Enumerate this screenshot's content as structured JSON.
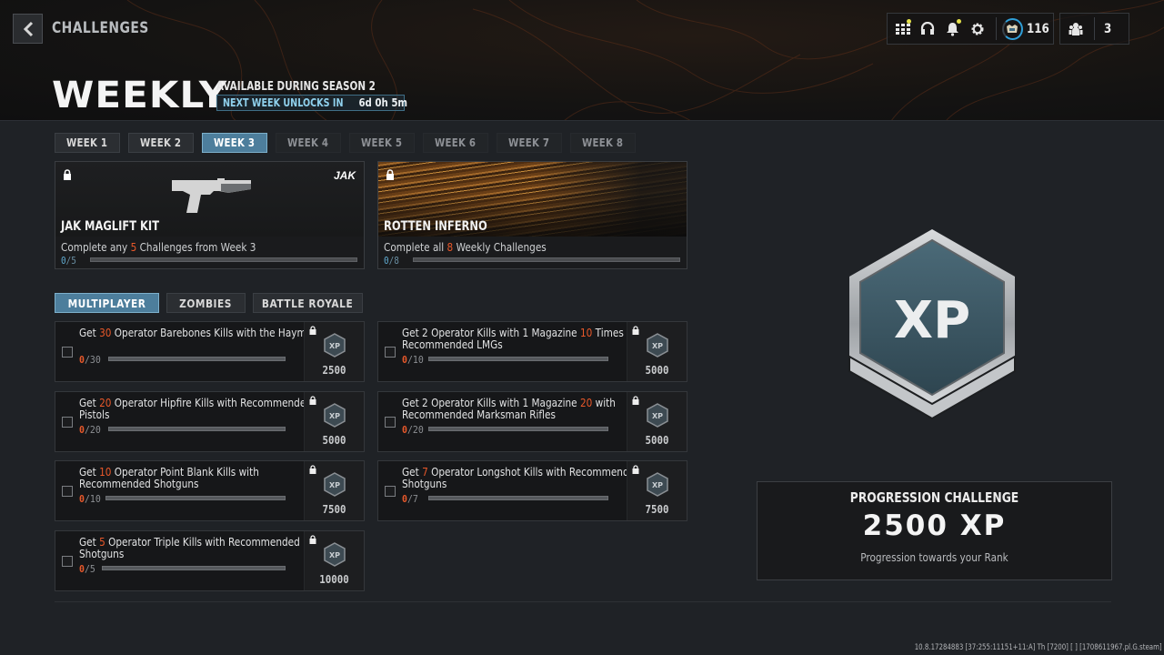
{
  "header": {
    "breadcrumb": "CHALLENGES",
    "title": "WEEKLY",
    "season": "AVAILABLE DURING SEASON 2",
    "unlock_label": "NEXT WEEK UNLOCKS IN",
    "unlock_time": "6d 0h 5m"
  },
  "hud": {
    "icons": [
      "apps-grid-icon",
      "headset-icon",
      "bell-icon",
      "gear-icon"
    ],
    "rank_level": "116",
    "party_count": "3"
  },
  "weeks": [
    {
      "label": "WEEK 1",
      "state": "done"
    },
    {
      "label": "WEEK 2",
      "state": "done"
    },
    {
      "label": "WEEK 3",
      "state": "active"
    },
    {
      "label": "WEEK 4",
      "state": "locked"
    },
    {
      "label": "WEEK 5",
      "state": "locked"
    },
    {
      "label": "WEEK 6",
      "state": "locked"
    },
    {
      "label": "WEEK 7",
      "state": "locked"
    },
    {
      "label": "WEEK 8",
      "state": "locked"
    }
  ],
  "rewards": [
    {
      "name": "JAK MAGLIFT KIT",
      "brand": "JAK",
      "desc_pre": "Complete any ",
      "desc_num": "5",
      "desc_post": " Challenges from Week 3",
      "current": "0",
      "total": "5",
      "progress": 0
    },
    {
      "name": "ROTTEN INFERNO",
      "desc_pre": "Complete all ",
      "desc_num": "8",
      "desc_post": " Weekly Challenges",
      "current": "0",
      "total": "8",
      "progress": 0
    }
  ],
  "modes": [
    {
      "label": "MULTIPLAYER",
      "active": true
    },
    {
      "label": "ZOMBIES",
      "active": false
    },
    {
      "label": "BATTLE ROYALE",
      "active": false
    }
  ],
  "challenges": [
    {
      "pre": "Get ",
      "num": "30",
      "post": " Operator Barebones Kills with the Haymaker",
      "current": "0",
      "total": "30",
      "xp": "2500",
      "progress": 0
    },
    {
      "pre": "Get 2 Operator Kills with 1 Magazine ",
      "num": "10",
      "post": " Times with Recommended LMGs",
      "current": "0",
      "total": "10",
      "xp": "5000",
      "progress": 0
    },
    {
      "pre": "Get ",
      "num": "20",
      "post": " Operator Hipfire Kills with Recommended Pistols",
      "current": "0",
      "total": "20",
      "xp": "5000",
      "progress": 0
    },
    {
      "pre": "Get 2 Operator Kills with 1 Magazine ",
      "num": "20",
      "post": " with Recommended Marksman Rifles",
      "current": "0",
      "total": "20",
      "xp": "5000",
      "progress": 0
    },
    {
      "pre": "Get ",
      "num": "10",
      "post": " Operator Point Blank Kills with Recommended Shotguns",
      "current": "0",
      "total": "10",
      "xp": "7500",
      "progress": 0
    },
    {
      "pre": "Get ",
      "num": "7",
      "post": " Operator Longshot Kills with Recommended Shotguns",
      "current": "0",
      "total": "7",
      "xp": "7500",
      "progress": 0
    },
    {
      "pre": "Get ",
      "num": "5",
      "post": " Operator Triple Kills with Recommended Shotguns",
      "current": "0",
      "total": "5",
      "xp": "10000",
      "progress": 0
    }
  ],
  "progression": {
    "badge_text": "XP",
    "title": "PROGRESSION CHALLENGE",
    "xp": "2500 XP",
    "subtitle": "Progression towards your Rank"
  },
  "build_info": "10.8.17284883 [37:255:11151+11:A] Th [7200] [ ] [1708611967.pl.G.steam]",
  "colors": {
    "accent_blue": "#4d7e9c",
    "highlight_orange": "#e8582a",
    "progress_blue": "#5fa9cf",
    "notification_yellow": "#e4e04a"
  }
}
